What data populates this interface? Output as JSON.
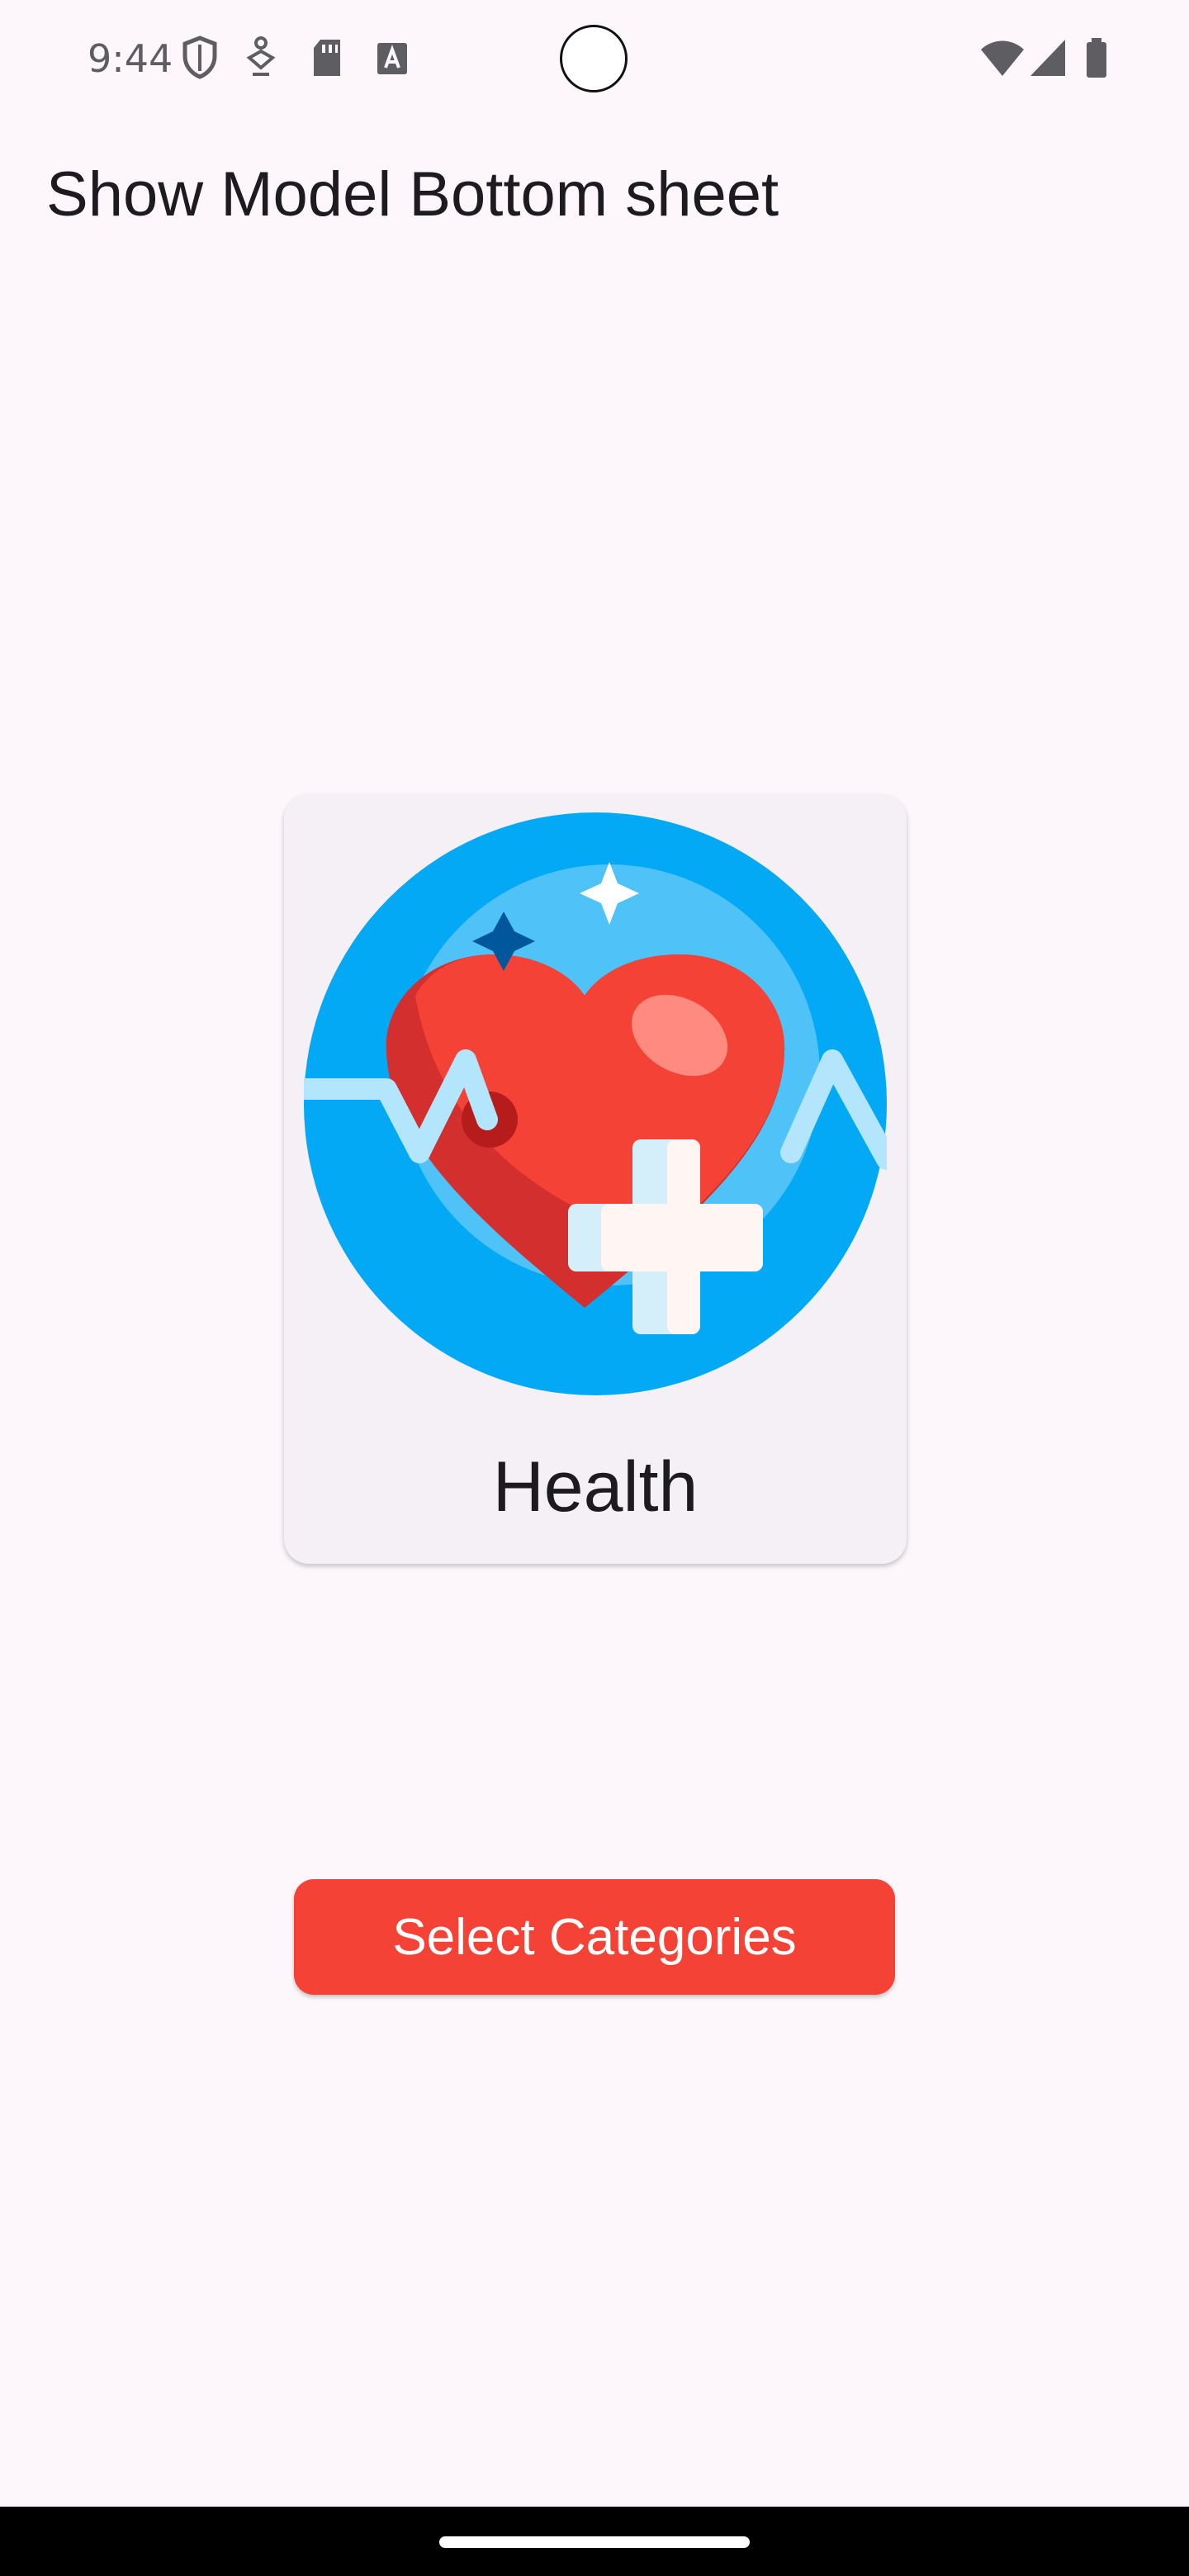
{
  "status_bar": {
    "time": "9:44",
    "left_icons": [
      "shield-icon",
      "accessibility-icon",
      "sd-card-icon",
      "font-icon"
    ],
    "right_icons": [
      "wifi-icon",
      "cell-signal-icon",
      "battery-icon"
    ]
  },
  "app_bar": {
    "title": "Show Model Bottom sheet"
  },
  "card": {
    "label": "Health",
    "icon": "health-heart-icon"
  },
  "actions": {
    "select_categories_label": "Select Categories"
  },
  "colors": {
    "background": "#FDF7FC",
    "card": "#F5F0F5",
    "accent": "#F44336",
    "circle_blue": "#03A9F4",
    "heart_red": "#F44336"
  }
}
